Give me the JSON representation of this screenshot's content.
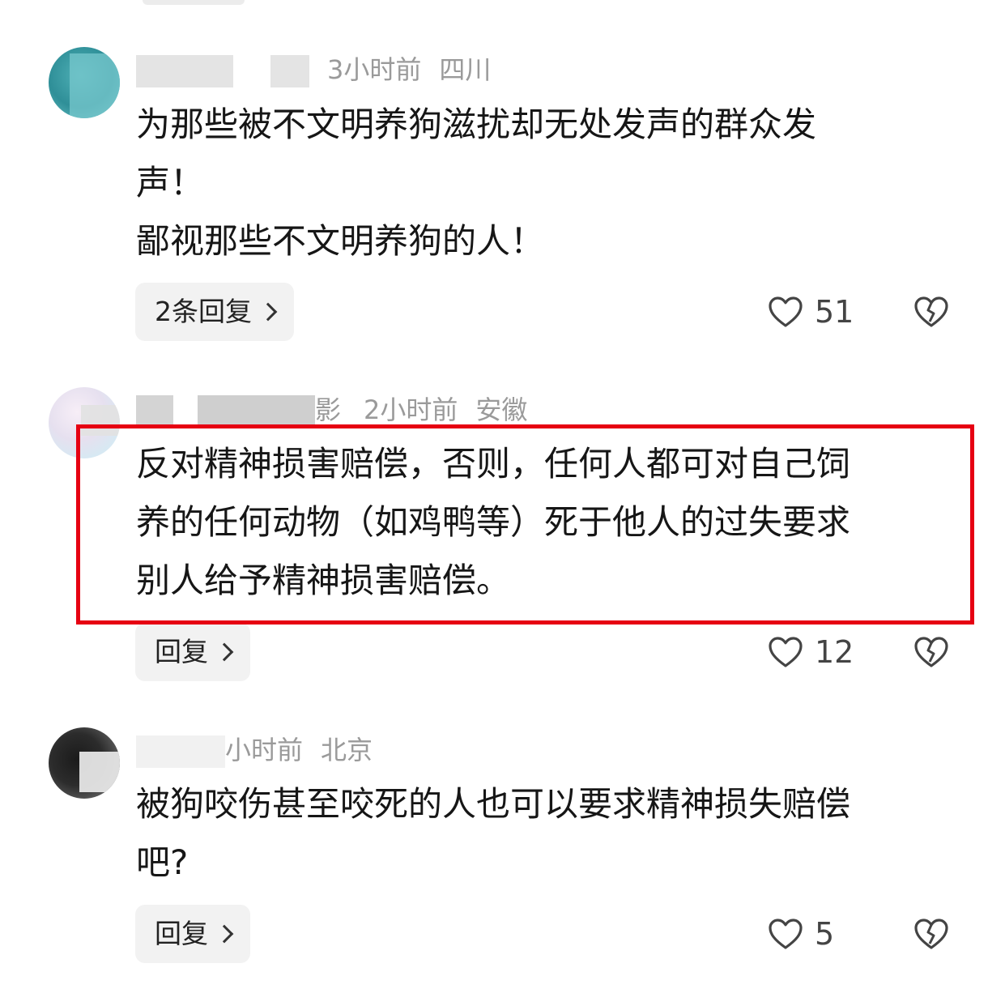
{
  "comments": [
    {
      "time": "3小时前",
      "location": "四川",
      "text": "为那些被不文明养狗滋扰却无处发声的群众发\n声！\n鄙视那些不文明养狗的人！",
      "reply_label": "2条回复",
      "likes": "51",
      "username_partial": "",
      "highlighted": false
    },
    {
      "time": "2小时前",
      "location": "安徽",
      "text": "反对精神损害赔偿，否则，任何人都可对自己饲\n养的任何动物（如鸡鸭等）死于他人的过失要求\n别人给予精神损害赔偿。",
      "reply_label": "回复",
      "likes": "12",
      "username_partial": "影",
      "highlighted": true
    },
    {
      "time": "小时前",
      "location": "北京",
      "text": "被狗咬伤甚至咬死的人也可以要求精神损失赔偿\n吧?",
      "reply_label": "回复",
      "likes": "5",
      "username_partial": "",
      "highlighted": false
    }
  ],
  "colors": {
    "highlight": "#e60012",
    "meta": "#9a9a9a",
    "reply_bg": "#f2f2f2"
  },
  "icons": {
    "like": "heart-outline-icon",
    "dislike": "broken-heart-icon",
    "reply": "chevron-right-icon"
  }
}
